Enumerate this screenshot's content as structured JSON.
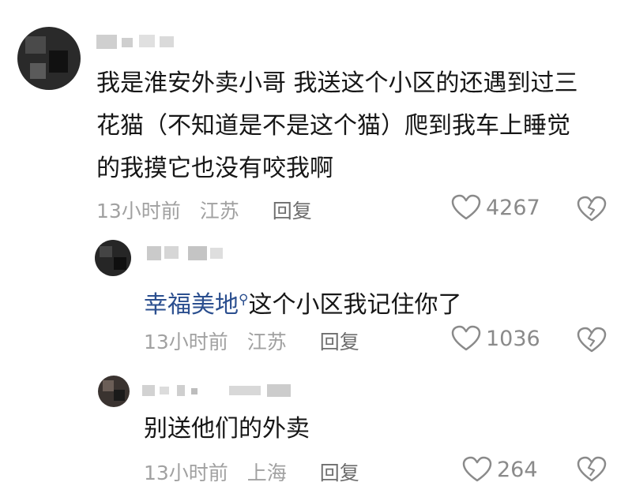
{
  "colors": {
    "text": "#161616",
    "meta": "#a1a1a1",
    "reply": "#6e6e6e",
    "link": "#2b4f8f",
    "count": "#8a8a8a"
  },
  "comments": [
    {
      "lines": [
        "我是淮安外卖小哥 我送这个小区的还遇到过三",
        "花猫（不知道是不是这个猫）爬到我车上睡觉",
        "的我摸它也没有咬我啊"
      ],
      "time": "13小时前",
      "location": "江苏",
      "reply": "回复",
      "likes": "4267",
      "like_icon": "heart-outline-icon",
      "dislike_icon": "broken-heart-icon"
    }
  ],
  "replies": [
    {
      "link_text": "幸福美地",
      "link_icon": "search-icon",
      "text": "这个小区我记住你了",
      "time": "13小时前",
      "location": "江苏",
      "reply": "回复",
      "likes": "1036"
    },
    {
      "text": "别送他们的外卖",
      "time": "13小时前",
      "location": "上海",
      "reply": "回复",
      "likes": "264"
    }
  ]
}
